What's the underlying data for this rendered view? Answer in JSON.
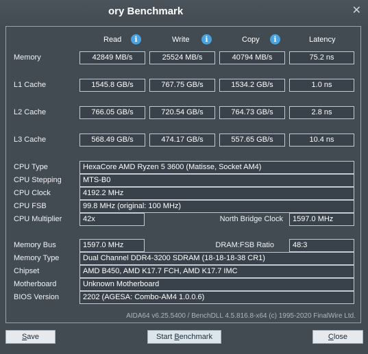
{
  "window": {
    "title": "ory Benchmark",
    "close_glyph": "✕"
  },
  "columns": {
    "read": "Read",
    "write": "Write",
    "copy": "Copy",
    "latency": "Latency",
    "info_glyph": "i"
  },
  "bench": [
    {
      "label": "Memory",
      "read": "42849 MB/s",
      "write": "25524 MB/s",
      "copy": "40794 MB/s",
      "latency": "75.2 ns"
    },
    {
      "label": "L1 Cache",
      "read": "1545.8 GB/s",
      "write": "767.75 GB/s",
      "copy": "1534.2 GB/s",
      "latency": "1.0 ns"
    },
    {
      "label": "L2 Cache",
      "read": "766.05 GB/s",
      "write": "720.54 GB/s",
      "copy": "764.73 GB/s",
      "latency": "2.8 ns"
    },
    {
      "label": "L3 Cache",
      "read": "568.49 GB/s",
      "write": "474.17 GB/s",
      "copy": "557.65 GB/s",
      "latency": "10.4 ns"
    }
  ],
  "cpu": {
    "type_label": "CPU Type",
    "type": "HexaCore AMD Ryzen 5 3600  (Matisse, Socket AM4)",
    "stepping_label": "CPU Stepping",
    "stepping": "MTS-B0",
    "clock_label": "CPU Clock",
    "clock": "4192.2 MHz",
    "fsb_label": "CPU FSB",
    "fsb": "99.8 MHz  (original: 100 MHz)",
    "multiplier_label": "CPU Multiplier",
    "multiplier": "42x",
    "nb_clock_label": "North Bridge Clock",
    "nb_clock": "1597.0 MHz"
  },
  "memory": {
    "bus_label": "Memory Bus",
    "bus": "1597.0 MHz",
    "ratio_label": "DRAM:FSB Ratio",
    "ratio": "48:3",
    "type_label": "Memory Type",
    "type": "Dual Channel DDR4-3200 SDRAM  (18-18-18-38 CR1)",
    "chipset_label": "Chipset",
    "chipset": "AMD B450, AMD K17.7 FCH, AMD K17.7 IMC",
    "motherboard_label": "Motherboard",
    "motherboard": "Unknown Motherboard",
    "bios_label": "BIOS Version",
    "bios": "2202  (AGESA: Combo-AM4 1.0.0.6)"
  },
  "footer": "AIDA64 v6.25.5400 / BenchDLL 4.5.816.8-x64  (c) 1995-2020 FinalWire Ltd.",
  "buttons": {
    "save_u": "S",
    "save_rest": "ave",
    "start_pre": "Start ",
    "start_u": "B",
    "start_rest": "enchmark",
    "close_u": "C",
    "close_rest": "lose"
  }
}
